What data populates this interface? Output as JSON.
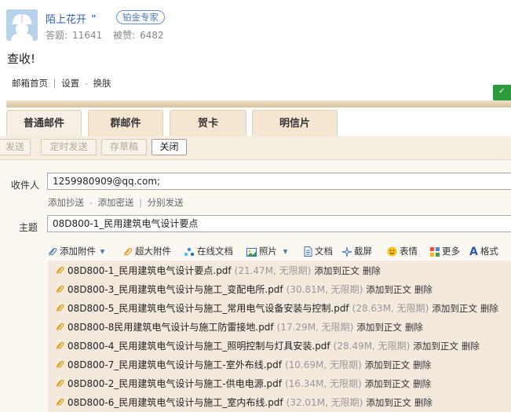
{
  "answer": {
    "user_name": "陌上花开",
    "quote_mark": "”",
    "badge": "铂金专家",
    "stats": {
      "answers_label": "答题:",
      "answers_value": "11641",
      "likes_label": "被赞:",
      "likes_value": "6482"
    },
    "text": "查收!"
  },
  "mail": {
    "nav": {
      "home": "邮箱首页",
      "divider": "|",
      "settings": "设置",
      "dash": "-",
      "skin": "换肤"
    },
    "tabs": [
      {
        "label": "普通邮件",
        "active": true
      },
      {
        "label": "群邮件",
        "active": false
      },
      {
        "label": "贺卡",
        "active": false
      },
      {
        "label": "明信片",
        "active": false
      }
    ],
    "toolbar": {
      "send": "发送",
      "scheduled": "定时发送",
      "draft": "存草稿",
      "close": "关闭"
    },
    "recipient_label": "收件人",
    "recipient_value": "1259980909@qq.com;",
    "cc_links": {
      "cc": "添加抄送",
      "dash1": "-",
      "bcc": "添加密送",
      "divider": "|",
      "separate": "分别发送"
    },
    "subject_label": "主题",
    "subject_value": "08D800-1_民用建筑电气设计要点",
    "attach_toolbar": {
      "add_attachment": "添加附件",
      "large_attachment": "超大附件",
      "online_doc": "在线文档",
      "photo": "照片",
      "document": "文档",
      "screenshot": "截屏",
      "emoji": "表情",
      "more": "更多",
      "format": "格式"
    },
    "attachments": [
      {
        "name": "08D800-1_民用建筑电气设计要点.pdf",
        "meta": "(21.47M, 无限期)",
        "add": "添加到正文",
        "delete": "删除"
      },
      {
        "name": "08D800-3_民用建筑电气设计与施工_变配电所.pdf",
        "meta": "(30.81M, 无限期)",
        "add": "添加到正文",
        "delete": "删除"
      },
      {
        "name": "08D800-5_民用建筑电气设计与施工_常用电气设备安装与控制.pdf",
        "meta": "(28.63M, 无限期)",
        "add": "添加到正文",
        "delete": "删除"
      },
      {
        "name": "08D800-8民用建筑电气设计与施工防雷接地.pdf",
        "meta": "(17.29M, 无限期)",
        "add": "添加到正文",
        "delete": "删除"
      },
      {
        "name": "08D800-4_民用建筑电气设计与施工_照明控制与灯具安装.pdf",
        "meta": "(28.49M, 无限期)",
        "add": "添加到正文",
        "delete": "删除"
      },
      {
        "name": "08D800-7_民用建筑电气设计与施工-室外布线.pdf",
        "meta": "(10.69M, 无限期)",
        "add": "添加到正文",
        "delete": "删除"
      },
      {
        "name": "08D800-2_民用建筑电气设计与施工-供电电源.pdf",
        "meta": "(16.34M, 无限期)",
        "add": "添加到正文",
        "delete": "删除"
      },
      {
        "name": "08D800-6_民用建筑电气设计与施工_室内布线.pdf",
        "meta": "(32.01M, 无限期)",
        "add": "添加到正文",
        "delete": "删除"
      }
    ]
  },
  "colors": {
    "accent_blue": "#2a5db0",
    "tab_bg": "#f4e6d1",
    "green_button": "#2d9a3c",
    "clip_gold": "#d5a018"
  }
}
